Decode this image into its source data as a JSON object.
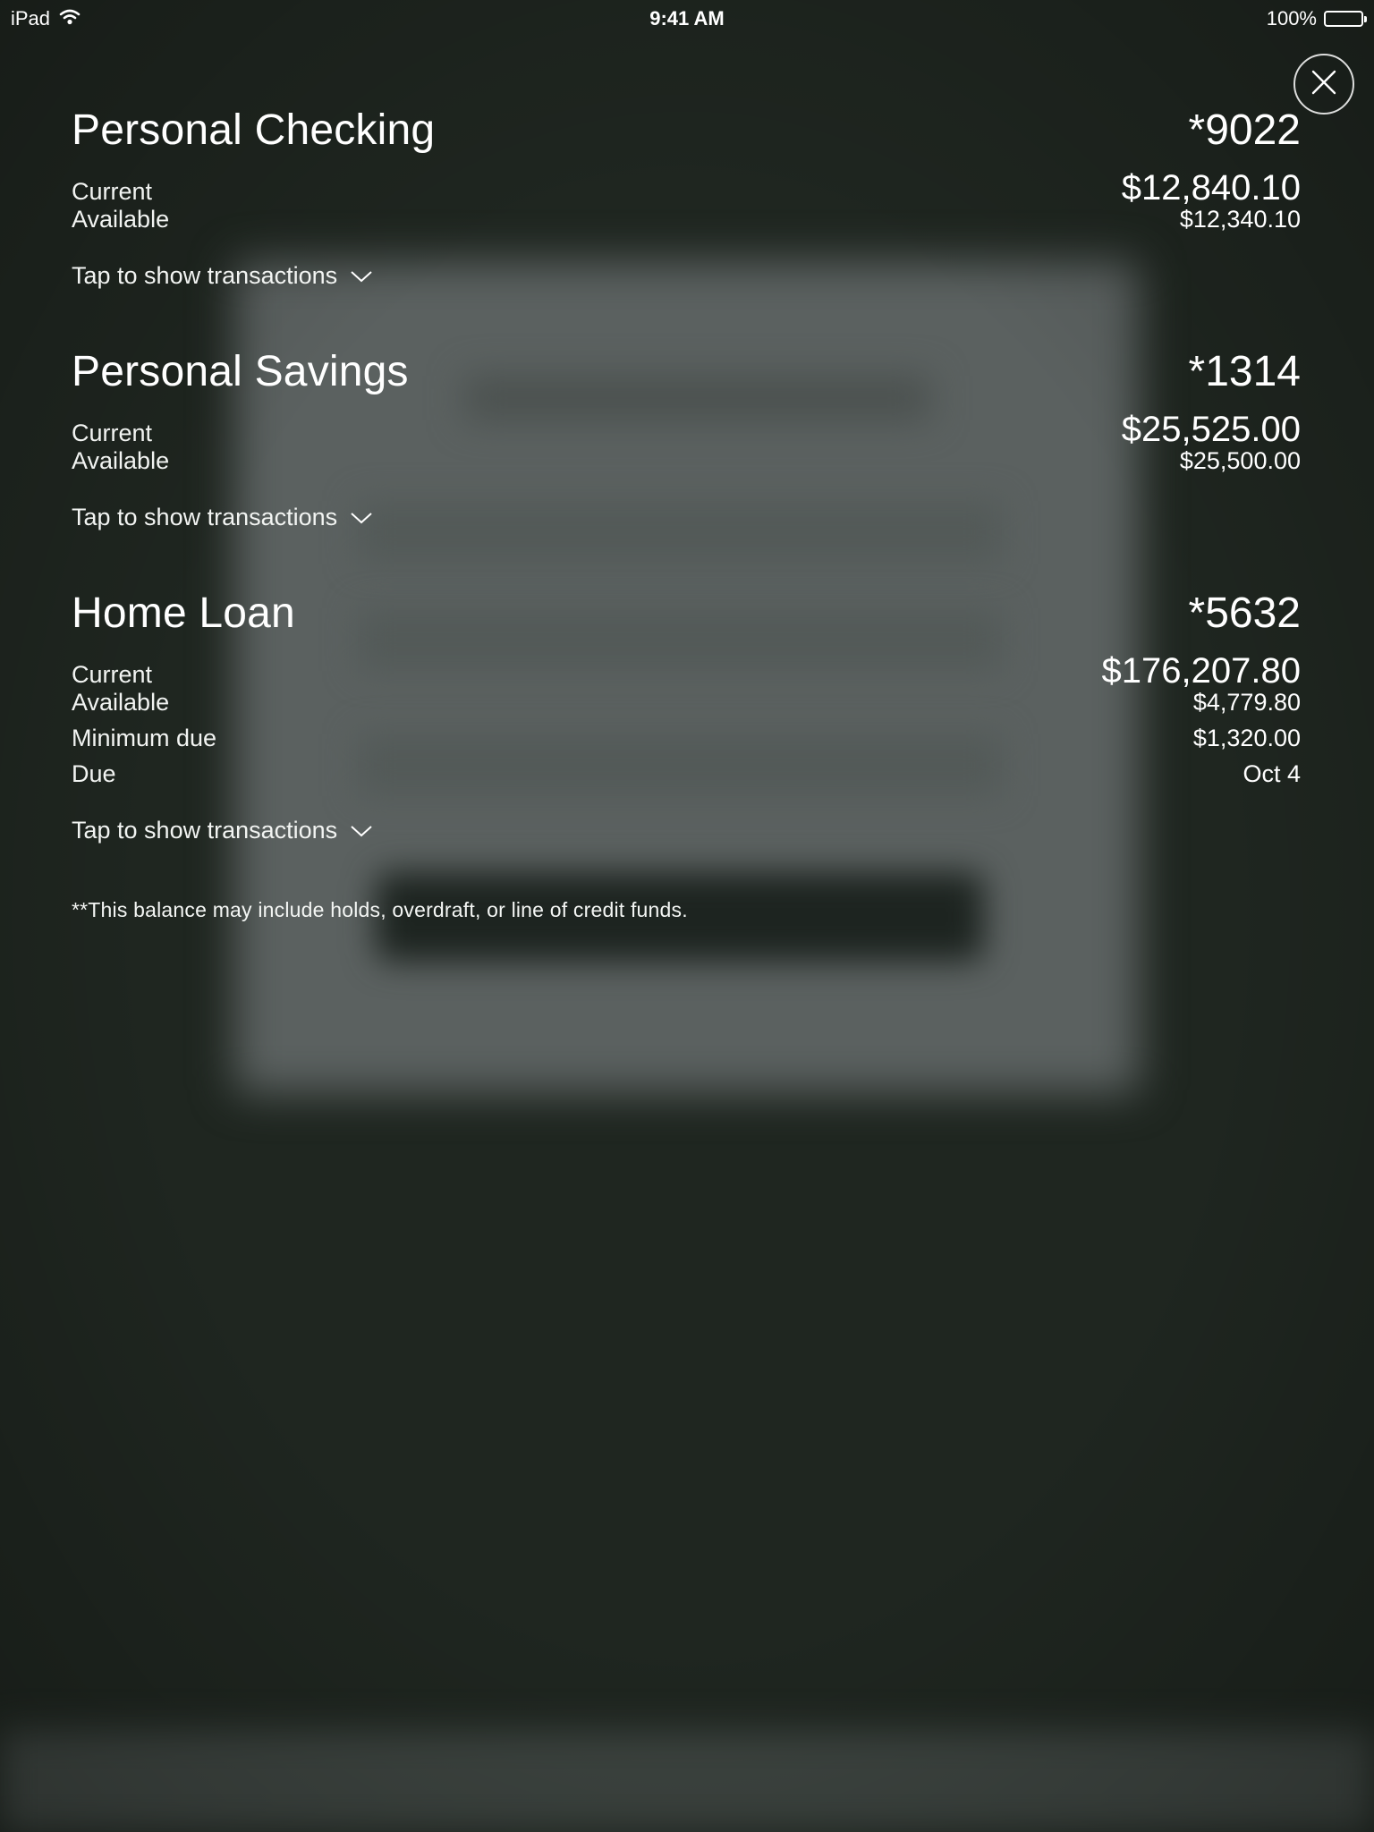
{
  "status_bar": {
    "device": "iPad",
    "time": "9:41 AM",
    "battery": "100%"
  },
  "icons": {
    "wifi": "wifi-icon",
    "battery": "battery-icon",
    "close": "close-icon",
    "chevron": "chevron-down-icon"
  },
  "accounts": [
    {
      "name": "Personal Checking",
      "number": "*9022",
      "rows": [
        {
          "label": "Current",
          "value": "$12,840.10"
        },
        {
          "label": "Available",
          "value": "$12,340.10"
        }
      ],
      "toggle": "Tap to show transactions"
    },
    {
      "name": "Personal Savings",
      "number": "*1314",
      "rows": [
        {
          "label": "Current",
          "value": "$25,525.00"
        },
        {
          "label": "Available",
          "value": "$25,500.00"
        }
      ],
      "toggle": "Tap to show transactions"
    },
    {
      "name": "Home Loan",
      "number": "*5632",
      "rows": [
        {
          "label": "Current",
          "value": "$176,207.80"
        },
        {
          "label": "Available",
          "value": "$4,779.80"
        },
        {
          "label": "Minimum due",
          "value": "$1,320.00"
        },
        {
          "label": "Due",
          "value": "Oct 4"
        }
      ],
      "toggle": "Tap to show transactions"
    }
  ],
  "disclaimer": "**This balance may include holds, overdraft, or line of credit funds.",
  "colors": {
    "background": "#1f2620",
    "text": "#ffffff"
  }
}
